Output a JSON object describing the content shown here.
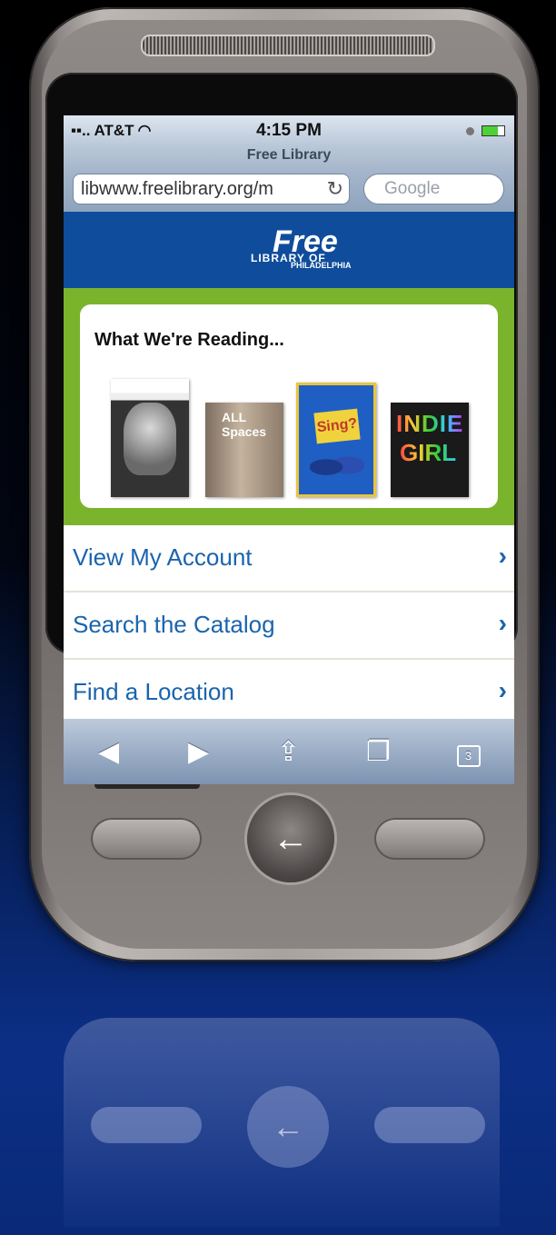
{
  "status": {
    "carrier": "AT&T",
    "time": "4:15 PM"
  },
  "browser": {
    "title": "Free Library",
    "url": "libwww.freelibrary.org/m",
    "search_placeholder": "Google"
  },
  "logo": {
    "free": "Free",
    "library": "LIBRARY OF",
    "city": "PHILADELPHIA"
  },
  "reading": {
    "heading": "What We're Reading...",
    "books": [
      {
        "name": "steve-jobs"
      },
      {
        "name": "small-spaces",
        "cover_text": "ALL Spaces"
      },
      {
        "name": "why-do-birds-sing",
        "cover_text": "Sing?"
      },
      {
        "name": "indie-girl",
        "cover_text_1": "INDIE",
        "cover_text_2": "GIRL"
      }
    ]
  },
  "nav": [
    {
      "label": "View My Account"
    },
    {
      "label": "Search the Catalog"
    },
    {
      "label": "Find a Location"
    }
  ],
  "toolbar": {
    "tabs_count": "3"
  },
  "colors": {
    "header_blue": "#0f4d9c",
    "green": "#7ab42c",
    "link_blue": "#1a64ad"
  }
}
